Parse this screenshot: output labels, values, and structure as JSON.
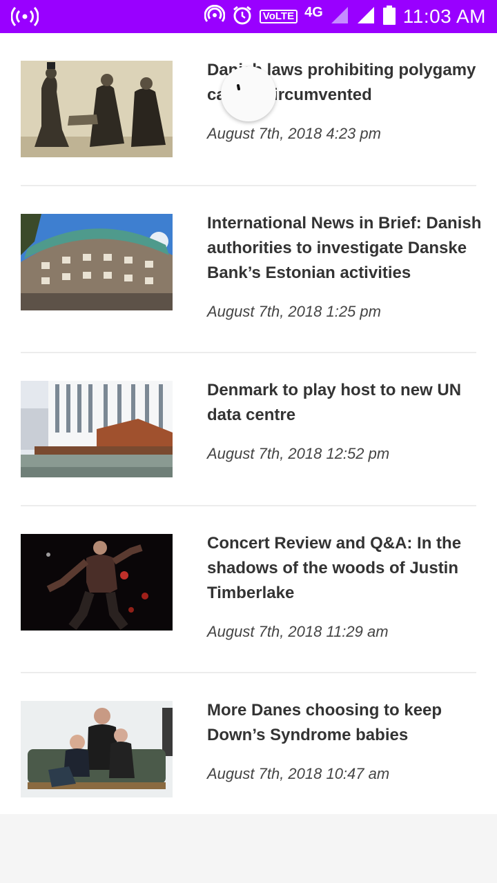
{
  "status_bar": {
    "time": "11:03 AM",
    "volte": "VoLTE",
    "network": "4G",
    "color": "#9900ff"
  },
  "articles": [
    {
      "title": "Danish laws prohibiting polygamy can be circumvented",
      "date": "August 7th, 2018 4:23 pm"
    },
    {
      "title": "International News in Brief: Danish authorities to investigate Danske Bank’s Estonian activities",
      "date": "August 7th, 2018 1:25 pm"
    },
    {
      "title": "Denmark to play host to new UN data centre",
      "date": "August 7th, 2018 12:52 pm"
    },
    {
      "title": "Concert Review and Q&A: In the shadows of the woods of Justin Timberlake",
      "date": "August 7th, 2018 11:29 am"
    },
    {
      "title": "More Danes choosing to keep Down’s Syndrome babies",
      "date": "August 7th, 2018 10:47 am"
    }
  ]
}
